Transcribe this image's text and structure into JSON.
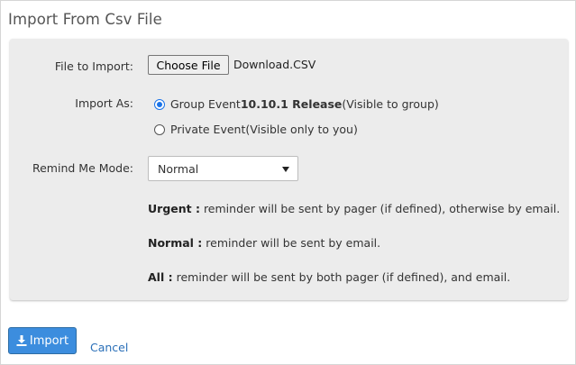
{
  "dialog": {
    "title": "Import From Csv File"
  },
  "file_import": {
    "label": "File to Import:",
    "button_label": "Choose File",
    "file_name": "Download.CSV"
  },
  "import_as": {
    "label": "Import As:",
    "options": [
      {
        "prefix": "Group Event ",
        "bold": "10.10.1 Release",
        "suffix": "(Visible to group)",
        "checked": true
      },
      {
        "prefix": "Private Event(Visible only to you)",
        "bold": "",
        "suffix": "",
        "checked": false
      }
    ]
  },
  "remind_mode": {
    "label": "Remind Me Mode:",
    "selected": "Normal",
    "descriptions": [
      {
        "term": "Urgent :",
        "text": " reminder will be sent by pager (if defined), otherwise by email."
      },
      {
        "term": "Normal :",
        "text": " reminder will be sent by email."
      },
      {
        "term": "All :",
        "text": " reminder will be sent by both pager (if defined), and email."
      }
    ]
  },
  "actions": {
    "import_label": "Import",
    "cancel_label": "Cancel"
  },
  "colors": {
    "primary_button": "#3c8dde",
    "link": "#2a6fb8",
    "panel_bg": "#ececec",
    "radio_checked": "#1a73e8"
  },
  "icons": {
    "import_button_icon": "download-icon",
    "select_icon": "caret-down-icon"
  }
}
